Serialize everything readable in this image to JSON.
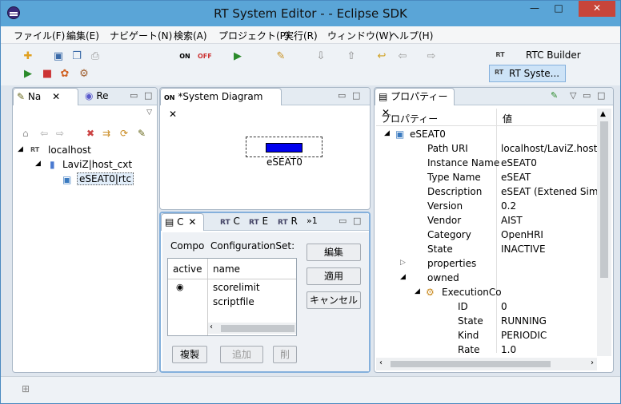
{
  "window": {
    "title": "RT System Editor -  - Eclipse SDK",
    "minimize": "—",
    "maximize": "□",
    "close": "✕"
  },
  "menu": [
    "ファイル(F)",
    "編集(E)",
    "ナビゲート(N)",
    "検索(A)",
    "プロジェクト(P)",
    "実行(R)",
    "ウィンドウ(W)",
    "ヘルプ(H)"
  ],
  "perspectives": {
    "builder": "RTC Builder",
    "system": "RT Syste..."
  },
  "nav": {
    "tab1": "Na",
    "tab2": "Re",
    "localhost": "localhost",
    "host": "LaviZ|host_cxt",
    "comp": "eSEAT0|rtc",
    "rt_glyph": "RT"
  },
  "diagram": {
    "tab": "*System Diagram",
    "comp_label": "eSEAT0",
    "comp_color": "#0000ee"
  },
  "config": {
    "tab_c": "C",
    "tab_e": "E",
    "tab_r": "R",
    "tab_rt": "RT",
    "tab_e2": "E",
    "more": "»1",
    "compo": "Compo",
    "configset": "ConfigurationSet:",
    "col_active": "active",
    "col_name": "name",
    "rows": [
      "scorelimit",
      "scriptfile"
    ],
    "btn_edit": "編集",
    "btn_apply": "適用",
    "btn_cancel": "キャンセル",
    "btn_copy": "複製",
    "btn_add": "追加",
    "btn_del": "削"
  },
  "props": {
    "tab": "プロパティー",
    "col_prop": "プロパティー",
    "col_val": "値",
    "root": "eSEAT0",
    "rows": [
      {
        "k": "Path URI",
        "v": "localhost/LaviZ.host"
      },
      {
        "k": "Instance Name",
        "v": "eSEAT0"
      },
      {
        "k": "Type Name",
        "v": "eSEAT"
      },
      {
        "k": "Description",
        "v": "eSEAT (Extened Sim"
      },
      {
        "k": "Version",
        "v": "0.2"
      },
      {
        "k": "Vendor",
        "v": "AIST"
      },
      {
        "k": "Category",
        "v": "OpenHRI"
      },
      {
        "k": "State",
        "v": "INACTIVE"
      },
      {
        "k": "properties",
        "v": ""
      },
      {
        "k": "owned",
        "v": ""
      },
      {
        "k": "ExecutionCo",
        "v": ""
      },
      {
        "k": "ID",
        "v": "0"
      },
      {
        "k": "State",
        "v": "RUNNING"
      },
      {
        "k": "Kind",
        "v": "PERIODIC"
      },
      {
        "k": "Rate",
        "v": "1.0"
      }
    ]
  }
}
